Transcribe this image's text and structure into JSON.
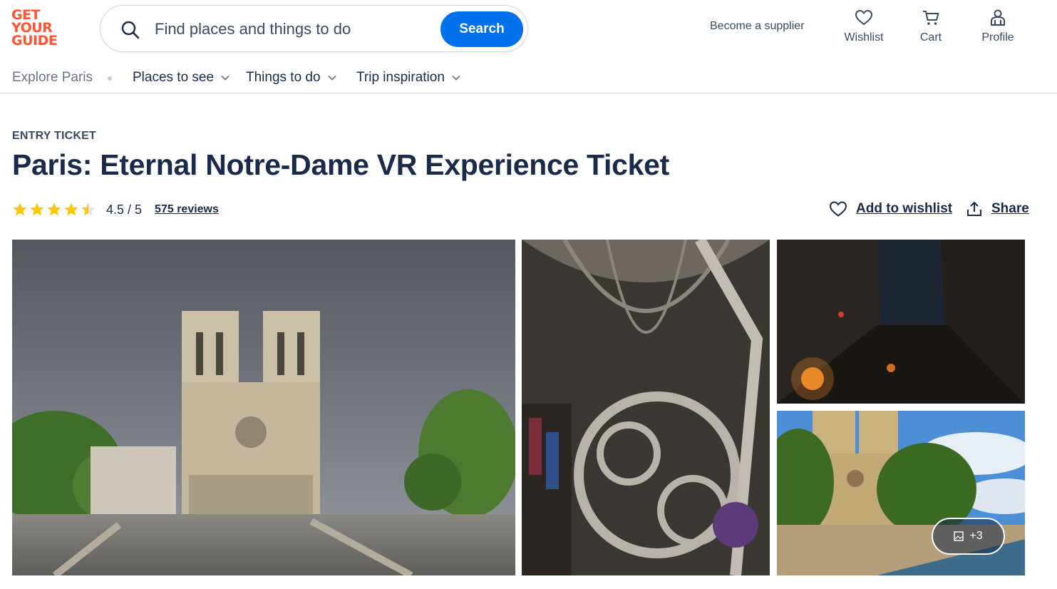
{
  "brand": {
    "logo_lines": [
      "GET",
      "YOUR",
      "GUIDE"
    ],
    "accent_color": "#ff5533",
    "primary_color": "#0071eb",
    "text_color": "#1a2b49"
  },
  "search": {
    "placeholder": "Find places and things to do",
    "button_label": "Search",
    "icon": "search-icon"
  },
  "header": {
    "supplier_link": "Become a supplier",
    "wishlist_label": "Wishlist",
    "cart_label": "Cart",
    "profile_label": "Profile"
  },
  "nav": {
    "explore": "Explore Paris",
    "items": [
      {
        "label": "Places to see"
      },
      {
        "label": "Things to do"
      },
      {
        "label": "Trip inspiration"
      }
    ]
  },
  "product": {
    "category": "ENTRY TICKET",
    "title": "Paris: Eternal Notre-Dame VR Experience Ticket",
    "rating": 4.5,
    "rating_text": "4.5 / 5",
    "reviews_text": "575 reviews",
    "star_color": "#fdc600",
    "add_to_wishlist": "Add to wishlist",
    "share": "Share"
  },
  "gallery": {
    "images": [
      {
        "subject": "Notre-Dame facade on a stormy day"
      },
      {
        "subject": "Gothic vaulted ceiling with tracery"
      },
      {
        "subject": "Medieval street at night with torch"
      },
      {
        "subject": "Notre-Dame seen from the Seine"
      }
    ],
    "more_count": "+3"
  }
}
